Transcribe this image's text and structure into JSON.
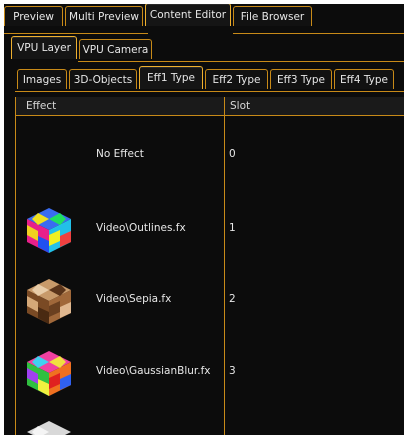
{
  "main_tabs": [
    {
      "label": "Preview",
      "active": false
    },
    {
      "label": "Multi Preview",
      "active": false
    },
    {
      "label": "Content Editor",
      "active": true
    },
    {
      "label": "File Browser",
      "active": false
    }
  ],
  "sub_tabs": [
    {
      "label": "VPU Layer",
      "active": true
    },
    {
      "label": "VPU Camera",
      "active": false
    }
  ],
  "type_tabs": [
    {
      "label": "Images",
      "active": false
    },
    {
      "label": "3D-Objects",
      "active": false
    },
    {
      "label": "Eff1 Type",
      "active": true
    },
    {
      "label": "Eff2 Type",
      "active": false
    },
    {
      "label": "Eff3 Type",
      "active": false
    },
    {
      "label": "Eff4 Type",
      "active": false
    }
  ],
  "table": {
    "columns": [
      "Effect",
      "Slot"
    ],
    "rows": [
      {
        "effect": "No Effect",
        "slot": "0",
        "thumbnail": "none"
      },
      {
        "effect": "Video\\Outlines.fx",
        "slot": "1",
        "thumbnail": "rainbow-outline-cube-icon"
      },
      {
        "effect": "Video\\Sepia.fx",
        "slot": "2",
        "thumbnail": "sepia-cube-icon"
      },
      {
        "effect": "Video\\GaussianBlur.fx",
        "slot": "3",
        "thumbnail": "rainbow-blur-cube-icon"
      }
    ]
  },
  "colors": {
    "accent": "#c88a18",
    "background": "#0c0c0c",
    "text": "#e8e8e8"
  }
}
